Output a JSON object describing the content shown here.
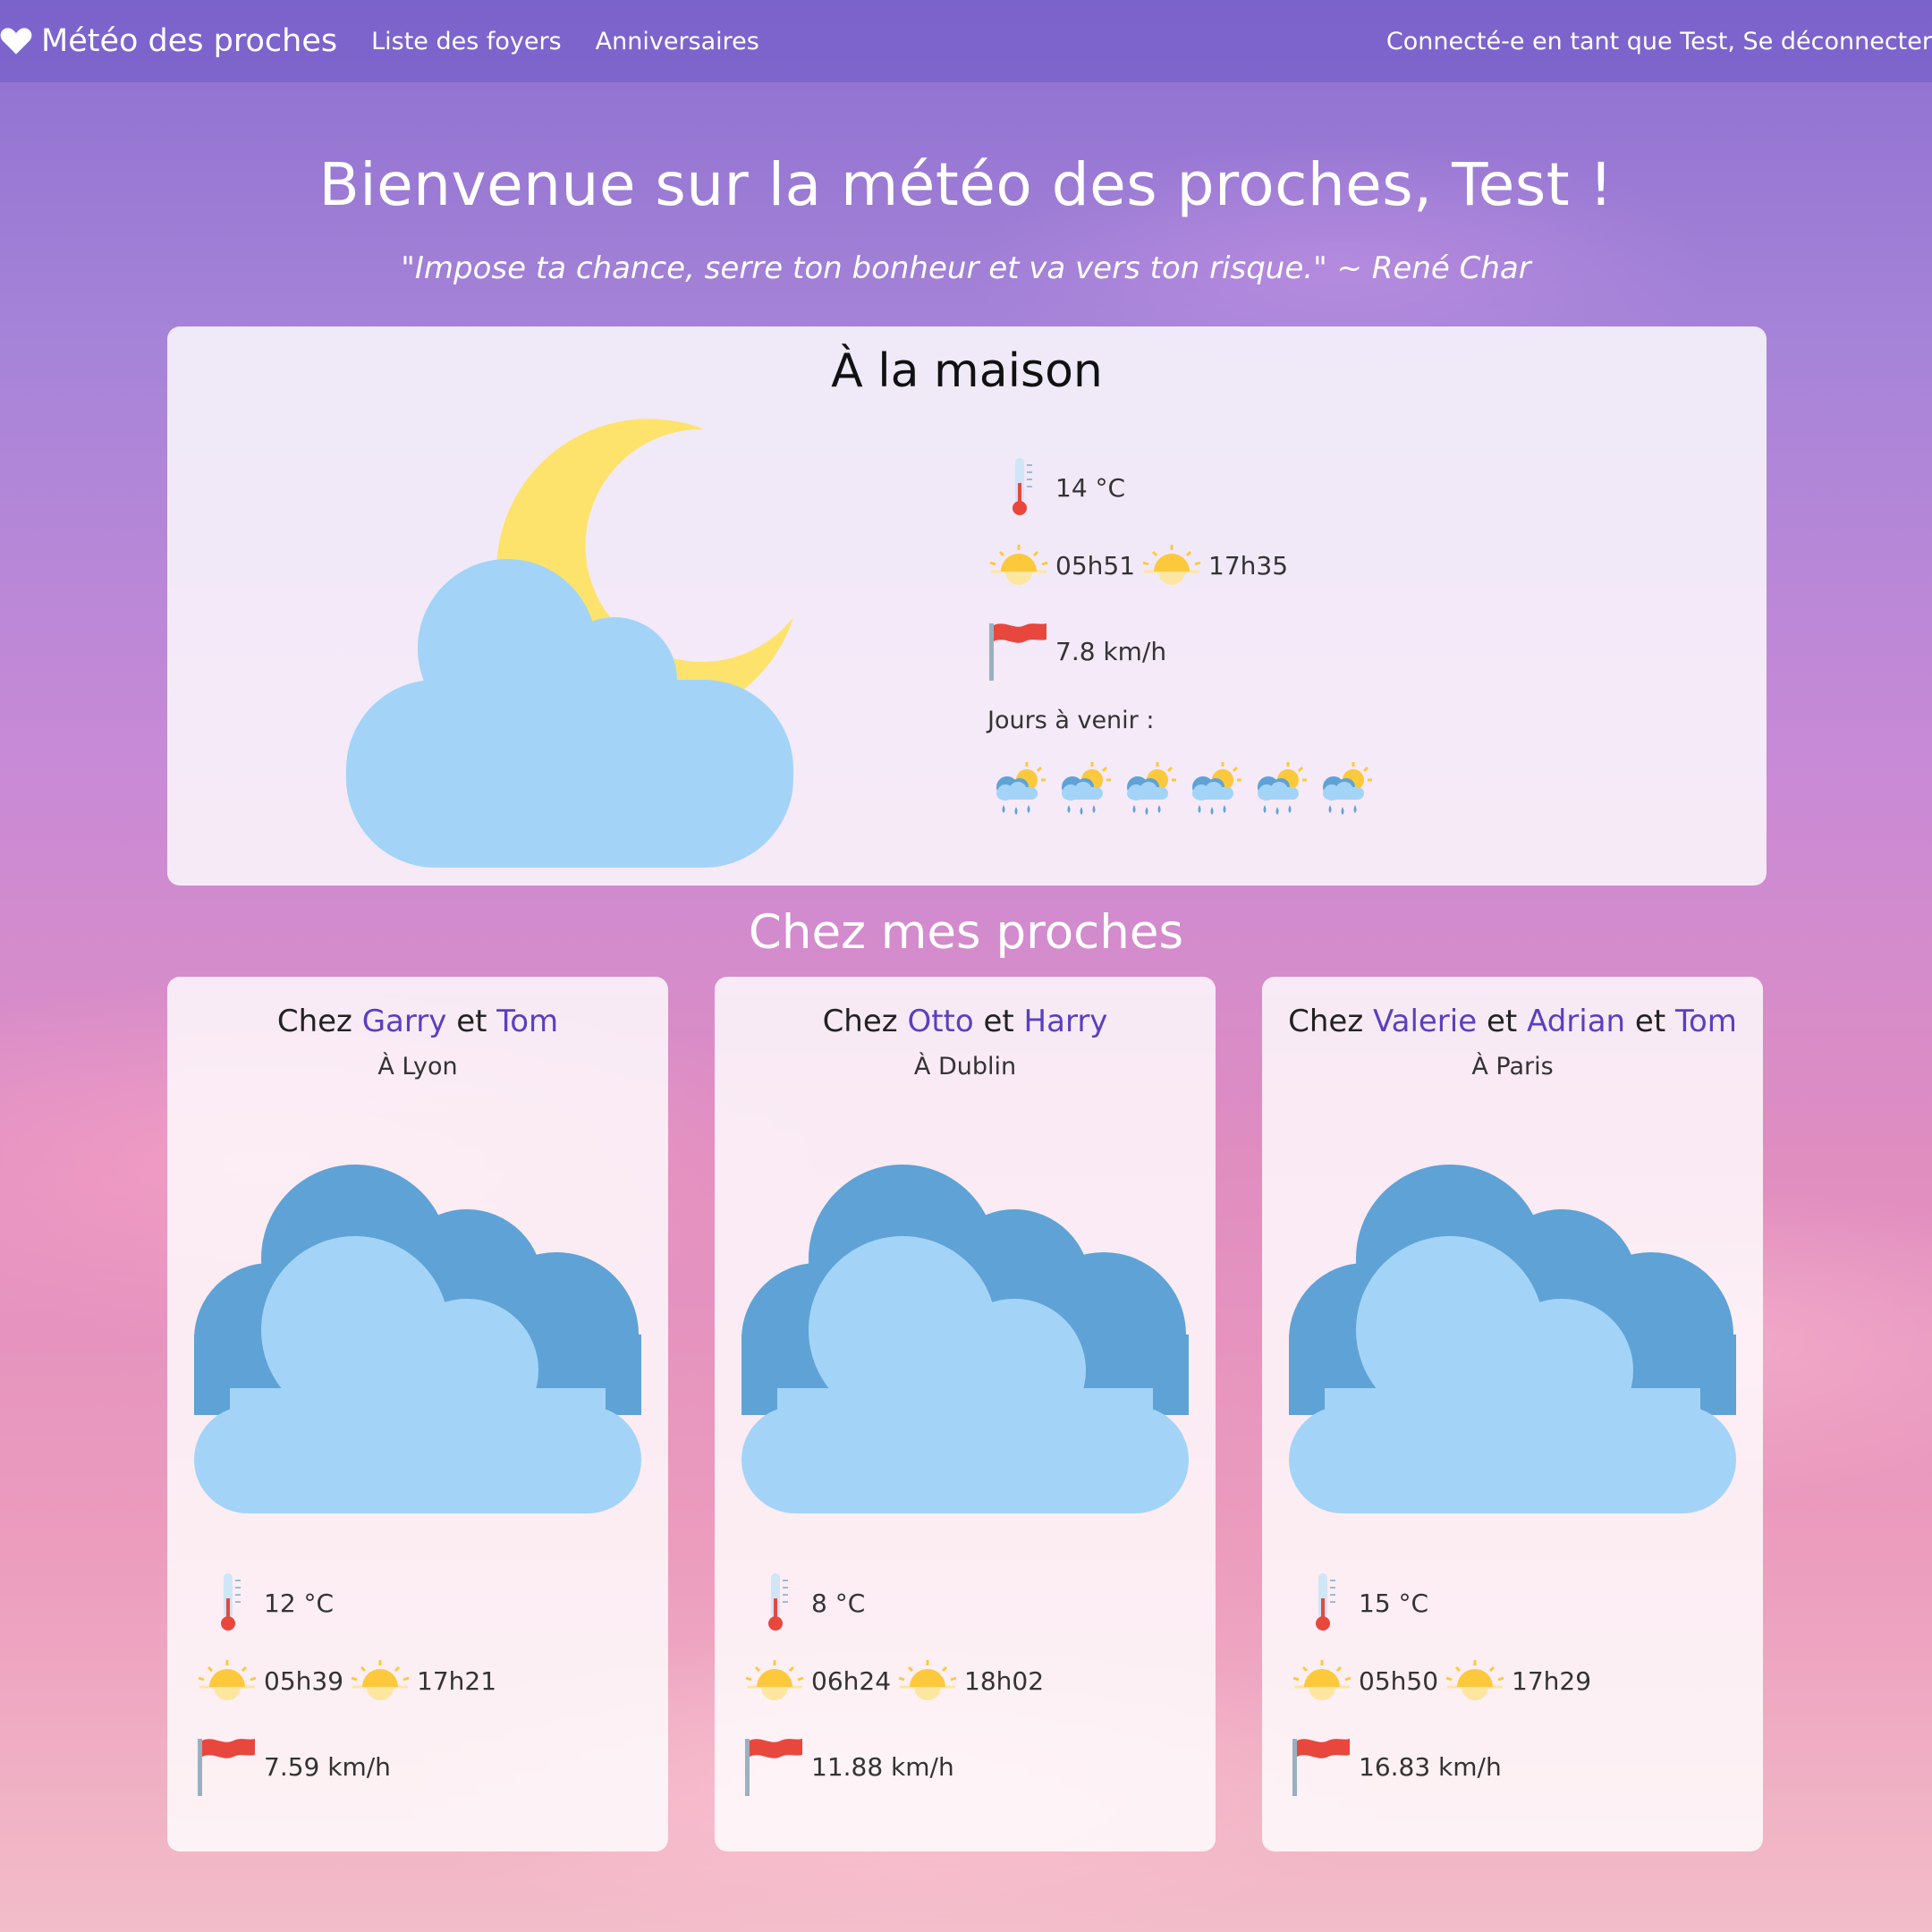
{
  "navbar": {
    "brand": "Météo des proches",
    "links": [
      "Liste des foyers",
      "Anniversaires"
    ],
    "user_text": "Connecté-e en tant que Test, Se déconnecter"
  },
  "hero": {
    "title": "Bienvenue sur la météo des proches, Test !",
    "quote": "\"Impose ta chance, serre ton bonheur et va vers ton risque.\" ~ René Char"
  },
  "home": {
    "title": "À la maison",
    "icon": "moon-cloud-icon",
    "temperature": "14 °C",
    "sunrise": "05h51",
    "sunset": "17h35",
    "wind": "7.8 km/h",
    "forecast_label": "Jours à venir :",
    "forecast_icons": [
      "rain-sun-icon",
      "rain-sun-icon",
      "rain-sun-icon",
      "rain-sun-icon",
      "rain-sun-icon",
      "rain-sun-icon"
    ]
  },
  "section_title": "Chez mes proches",
  "relatives": [
    {
      "prefix": "Chez",
      "names": [
        "Garry",
        "Tom"
      ],
      "connectors": [
        "et"
      ],
      "city": "À Lyon",
      "icon": "clouds-icon",
      "temperature": "12 °C",
      "sunrise": "05h39",
      "sunset": "17h21",
      "wind": "7.59 km/h"
    },
    {
      "prefix": "Chez",
      "names": [
        "Otto",
        "Harry"
      ],
      "connectors": [
        "et"
      ],
      "city": "À Dublin",
      "icon": "clouds-icon",
      "temperature": "8 °C",
      "sunrise": "06h24",
      "sunset": "18h02",
      "wind": "11.88 km/h"
    },
    {
      "prefix": "Chez",
      "names": [
        "Valerie",
        "Adrian",
        "Tom"
      ],
      "connectors": [
        "et",
        "et"
      ],
      "city": "À Paris",
      "icon": "clouds-icon",
      "temperature": "15 °C",
      "sunrise": "05h50",
      "sunset": "17h29",
      "wind": "16.83 km/h"
    }
  ],
  "colors": {
    "accent_link": "#5a3fc0",
    "cloud_light": "#a3d4f7",
    "cloud_dark": "#5fa2d6",
    "moon": "#fde36b",
    "flag": "#e8473e",
    "sun": "#fcc93c"
  }
}
